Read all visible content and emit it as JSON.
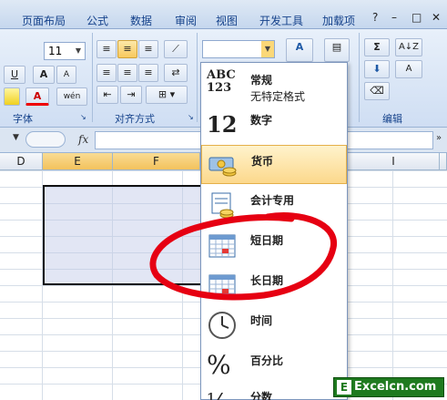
{
  "tabs": [
    "页面布局",
    "公式",
    "数据",
    "审阅",
    "视图",
    "开发工具",
    "加载项"
  ],
  "window_controls": {
    "minimize": "–",
    "restore": "□",
    "close": "✕",
    "help": "?"
  },
  "ribbon": {
    "font_size": "11",
    "font_group_label": "字体",
    "align_group_label": "对齐方式",
    "edit_group_label": "编辑",
    "format_label": "格",
    "buttons": {
      "underline": "U",
      "grow": "A",
      "shrink": "A",
      "font_color": "A",
      "phonetic": "wén",
      "sum": "Σ",
      "sort": "A↓Z",
      "find": "A"
    }
  },
  "formula_bar": {
    "fx": "fx"
  },
  "columns": [
    {
      "label": "D",
      "selected": false
    },
    {
      "label": "E",
      "selected": true
    },
    {
      "label": "F",
      "selected": true
    },
    {
      "label": "I",
      "selected": false
    }
  ],
  "number_format": {
    "current_value": "",
    "items": [
      {
        "label": "常规",
        "sub": "无特定格式",
        "icon": "abc-123-icon",
        "icon_text": "ABC\n123"
      },
      {
        "label": "数字",
        "sub": "",
        "icon": "number-12-icon",
        "icon_text": "12"
      },
      {
        "label": "货币",
        "sub": "",
        "icon": "currency-icon",
        "icon_text": ""
      },
      {
        "label": "会计专用",
        "sub": "",
        "icon": "accounting-icon",
        "icon_text": ""
      },
      {
        "label": "短日期",
        "sub": "",
        "icon": "calendar-icon",
        "icon_text": ""
      },
      {
        "label": "长日期",
        "sub": "",
        "icon": "calendar-icon",
        "icon_text": ""
      },
      {
        "label": "时间",
        "sub": "",
        "icon": "clock-icon",
        "icon_text": ""
      },
      {
        "label": "百分比",
        "sub": "",
        "icon": "percent-icon",
        "icon_text": "%"
      },
      {
        "label": "分数",
        "sub": "",
        "icon": "fraction-icon",
        "icon_text": "½"
      }
    ],
    "highlighted_index": 2
  },
  "watermark": {
    "text": "Excelcn.com",
    "badge": "E"
  },
  "colors": {
    "annotation": "#e60012",
    "highlight": "#fcd88c",
    "brand": "#15428b"
  }
}
